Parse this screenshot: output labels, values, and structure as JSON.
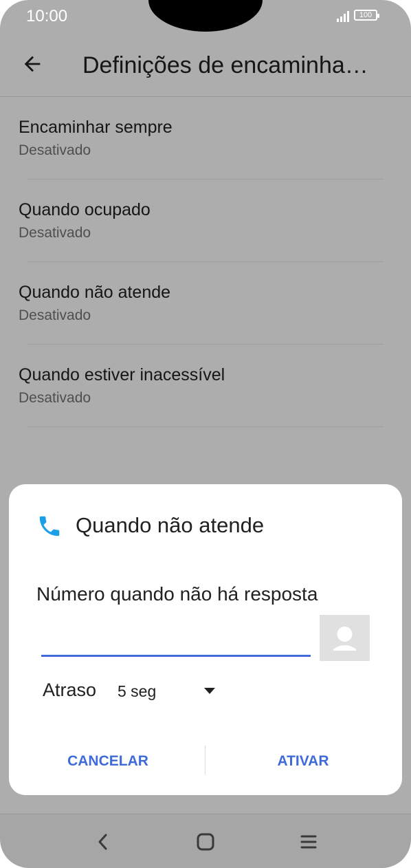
{
  "status_bar": {
    "time": "10:00",
    "battery": "100"
  },
  "app_bar": {
    "title": "Definições de encaminhamento de chamadas"
  },
  "list": {
    "items": [
      {
        "title": "Encaminhar sempre",
        "subtitle": "Desativado"
      },
      {
        "title": "Quando ocupado",
        "subtitle": "Desativado"
      },
      {
        "title": "Quando não atende",
        "subtitle": "Desativado"
      },
      {
        "title": "Quando estiver inacessível",
        "subtitle": "Desativado"
      }
    ]
  },
  "dialog": {
    "title": "Quando não atende",
    "field_label": "Número quando não há resposta",
    "number_value": "",
    "delay_label": "Atraso",
    "delay_value": "5 seg",
    "cancel_label": "CANCELAR",
    "activate_label": "ATIVAR"
  },
  "colors": {
    "accent": "#3f6bd8",
    "phone_icon": "#1aa0e6"
  }
}
